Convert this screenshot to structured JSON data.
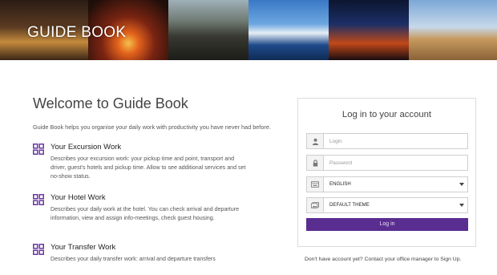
{
  "header": {
    "brand_title": "GUIDE BOOK"
  },
  "main": {
    "welcome_title": "Welcome to Guide Book",
    "intro_text": "Guide Book helps you organise your daily work with productivity you have never had before.",
    "features": [
      {
        "title": "Your Excursion Work",
        "description": "Describes your excursion work: your pickup time and point, transport and driver, guest's hotels and pickup time. Allow to see additional services and set no-show status.",
        "icon": "grid-icon"
      },
      {
        "title": "Your Hotel Work",
        "description": "Describes your daily work at the hotel. You can check arrival and departure information, view and assign info-meetings, check guest housing.",
        "icon": "grid-icon"
      },
      {
        "title": "Your Transfer Work",
        "description": "Describes your daily transfer work: arrival and departure transfers",
        "icon": "grid-icon"
      }
    ]
  },
  "login": {
    "title": "Log in to your account",
    "login_placeholder": "Login",
    "password_placeholder": "Password",
    "language_value": "ENGLISH",
    "theme_value": "DEFAULT THEME",
    "submit_label": "Log in",
    "signup_text": "Don't have account yet? Contact your office manager to Sign Up."
  },
  "colors": {
    "accent": "#5a2d91",
    "feature_icon": "#6a3aa0"
  }
}
